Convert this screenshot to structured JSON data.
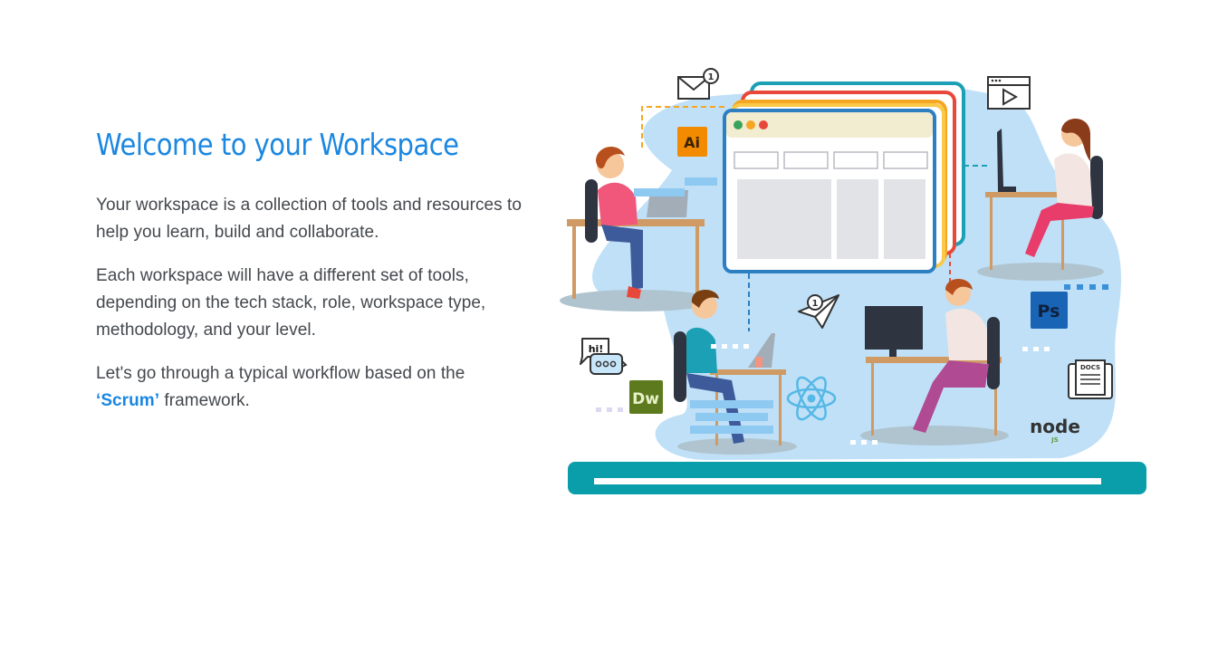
{
  "welcome": {
    "title": "Welcome to your Workspace",
    "paragraph_1": "Your workspace is a collection of tools and resources to help you learn, build and collaborate.",
    "paragraph_2": "Each workspace will have a different set of tools, depending on the tech stack, role, workspace type, methodology, and your level.",
    "paragraph_3_prefix": "Let's go through a typical workflow based on the",
    "paragraph_3_link": "‘Scrum’",
    "paragraph_3_suffix": " framework."
  },
  "illustration": {
    "icons": [
      "mail-icon",
      "illustrator-icon",
      "browser-window-icon",
      "video-player-icon",
      "photoshop-icon",
      "paper-plane-icon",
      "react-icon",
      "dreamweaver-icon",
      "chat-bubble-icon",
      "docs-icon",
      "nodejs-icon"
    ],
    "labels": {
      "mail_badge": "1",
      "plane_badge": "1",
      "illustrator": "Ai",
      "photoshop": "Ps",
      "dreamweaver": "Dw",
      "chat": "hi!",
      "docs": "DOCS",
      "node": "node",
      "node_js": "JS"
    },
    "colors": {
      "blob": "#bfe0f7",
      "floor": "#0a9eaa",
      "accent_teal": "#1ba0b5",
      "accent_red": "#e8483a",
      "accent_orange": "#f5a623",
      "accent_yellow": "#fbc94a",
      "window_border": "#2d7fc1"
    }
  }
}
